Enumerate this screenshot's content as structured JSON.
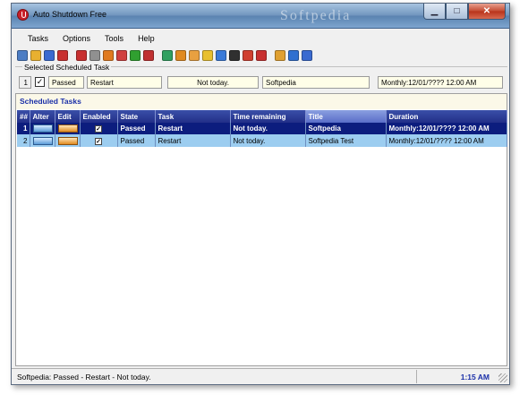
{
  "window": {
    "title": "Auto Shutdown Free",
    "watermark": "Softpedia"
  },
  "menu": [
    "Tasks",
    "Options",
    "Tools",
    "Help"
  ],
  "toolbar": {
    "icons": [
      "new-task-icon",
      "open-icon",
      "save-icon",
      "delete-icon",
      "shutdown-icon",
      "settings-icon",
      "timer-icon",
      "logoff-icon",
      "restart-icon",
      "power-icon",
      "hibernate-icon",
      "lock-icon",
      "alarm-icon",
      "standby-icon",
      "clock-icon",
      "info-icon",
      "note-icon",
      "edit-icon",
      "exit-icon",
      "window-icon",
      "help-icon"
    ],
    "colors": [
      "#4b7cc4",
      "#e8b030",
      "#3a6ad0",
      "#c83030",
      "#c83030",
      "#909090",
      "#e07a20",
      "#d04040",
      "#30a030",
      "#c03030",
      "#30a060",
      "#e08a20",
      "#e8a040",
      "#e8c030",
      "#3a7ad8",
      "#303030",
      "#d04030",
      "#c83030",
      "#e0a030",
      "#3070d0",
      "#3a6ad0"
    ]
  },
  "selected": {
    "legend": "Selected Scheduled Task",
    "num": "1",
    "checkbox_mark": "✓",
    "state": "Passed",
    "task": "Restart",
    "time_remaining": "Not today.",
    "title": "Softpedia",
    "duration": "Monthly:12/01/???? 12:00 AM"
  },
  "grid": {
    "heading": "Scheduled Tasks",
    "columns": [
      "##",
      "Alter",
      "Edit",
      "Enabled",
      "State",
      "Task",
      "Time remaining",
      "Title",
      "Duration"
    ],
    "rows": [
      {
        "num": "1",
        "enabled_mark": "✓",
        "state": "Passed",
        "task": "Restart",
        "time_remaining": "Not today.",
        "title": "Softpedia",
        "duration": "Monthly:12/01/???? 12:00 AM"
      },
      {
        "num": "2",
        "enabled_mark": "✓",
        "state": "Passed",
        "task": "Restart",
        "time_remaining": "Not today.",
        "title": "Softpedia Test",
        "duration": "Monthly:12/01/???? 12:00 AM"
      }
    ]
  },
  "status": {
    "text": "Softpedia:  Passed - Restart - Not today.",
    "time": "1:15 AM"
  }
}
